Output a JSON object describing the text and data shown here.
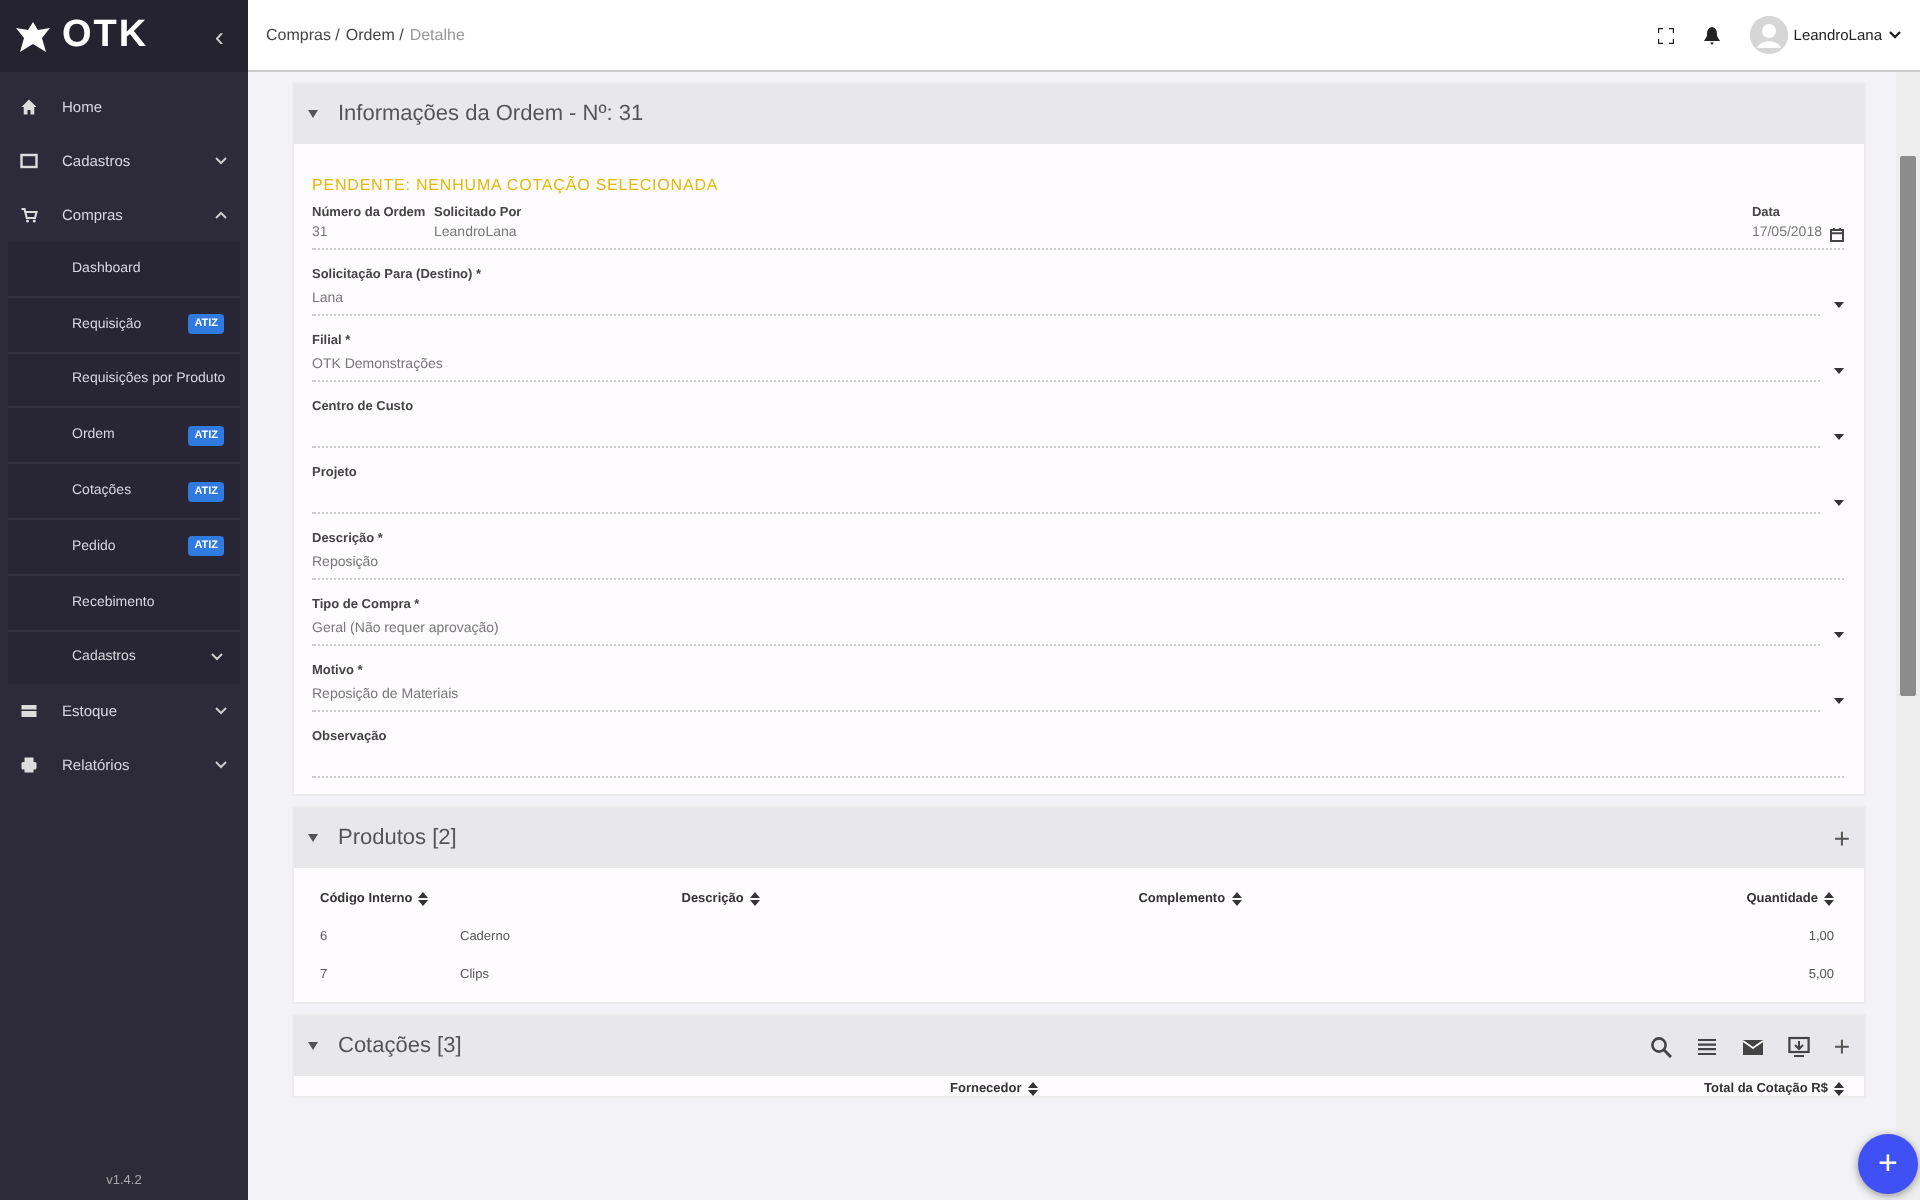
{
  "sidebar": {
    "logo": "OTK",
    "collapse": "‹",
    "version": "v1.4.2",
    "items": [
      {
        "label": "Home"
      },
      {
        "label": "Cadastros",
        "expanded": false
      },
      {
        "label": "Compras",
        "expanded": true,
        "children": [
          {
            "label": "Dashboard"
          },
          {
            "label": "Requisição",
            "badge": "ATIZ"
          },
          {
            "label": "Requisições por Produto"
          },
          {
            "label": "Ordem",
            "badge": "ATIZ"
          },
          {
            "label": "Cotações",
            "badge": "ATIZ"
          },
          {
            "label": "Pedido",
            "badge": "ATIZ"
          },
          {
            "label": "Recebimento"
          },
          {
            "label": "Cadastros",
            "expanded": false
          }
        ]
      },
      {
        "label": "Estoque",
        "expanded": false
      },
      {
        "label": "Relatórios",
        "expanded": false
      }
    ]
  },
  "topbar": {
    "breadcrumb": [
      "Compras /",
      "Ordem /",
      "Detalhe"
    ],
    "user": "LeandroLana"
  },
  "order_panel": {
    "title": "Informações da Ordem - Nº: 31",
    "status": "PENDENTE: NENHUMA COTAÇÃO SELECIONADA",
    "header_fields": [
      {
        "label": "Número da Ordem",
        "value": "31"
      },
      {
        "label": "Solicitado Por",
        "value": "LeandroLana"
      },
      {
        "label": "Data",
        "value": "17/05/2018"
      }
    ],
    "fields": [
      {
        "label": "Solicitação Para (Destino) *",
        "value": "Lana",
        "kind": "select"
      },
      {
        "label": "Filial *",
        "value": "OTK Demonstrações",
        "kind": "select"
      },
      {
        "label": "Centro de Custo",
        "kind": "select"
      },
      {
        "label": "Projeto",
        "kind": "select"
      },
      {
        "label": "Descrição *",
        "value": "Reposição",
        "kind": "text"
      },
      {
        "label": "Tipo de Compra *",
        "value": "Geral (Não requer aprovação)",
        "kind": "select"
      },
      {
        "label": "Motivo *",
        "value": "Reposição de Materiais",
        "kind": "select"
      },
      {
        "label": "Observação",
        "kind": "text"
      }
    ]
  },
  "products_panel": {
    "title": "Produtos [2]",
    "add": "+",
    "columns": [
      "Código Interno",
      "Descrição",
      "Complemento",
      "Quantidade"
    ],
    "rows": [
      {
        "code": "6",
        "description": "Caderno",
        "quantity": "1,00"
      },
      {
        "code": "7",
        "description": "Clips",
        "quantity": "5,00"
      }
    ]
  },
  "quotes_panel": {
    "title": "Cotações [3]",
    "add": "+",
    "columns": [
      "Fornecedor",
      "Total da Cotação R$"
    ]
  },
  "fab": "+"
}
